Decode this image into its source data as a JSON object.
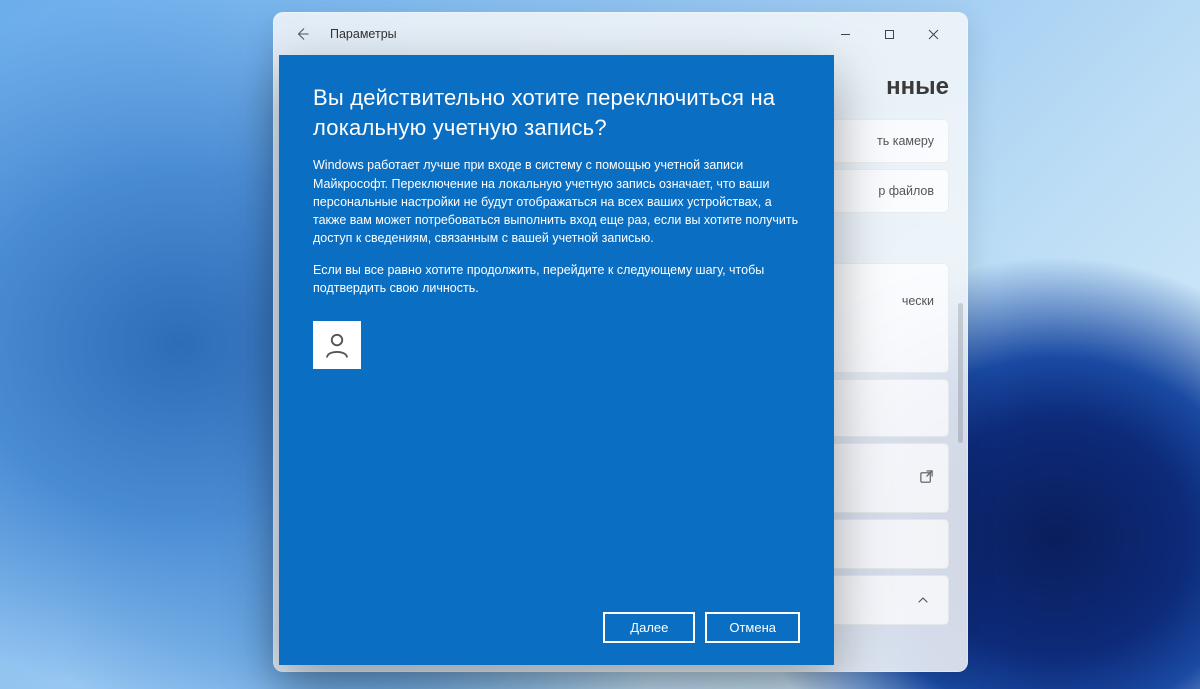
{
  "settings_window": {
    "title": "Параметры",
    "controls": {
      "back": "back-arrow",
      "minimize": "minimize",
      "maximize": "maximize",
      "close": "close"
    },
    "partial_heading": "нные",
    "cards": [
      {
        "text_fragment": "ть камеру"
      },
      {
        "text_fragment": "р файлов"
      },
      {
        "text_fragment": "чески"
      }
    ]
  },
  "modal": {
    "heading": "Вы действительно хотите переключиться на локальную учетную запись?",
    "body_paragraph_1": "Windows работает лучше при входе в систему с помощью учетной записи Майкрософт. Переключение на локальную учетную запись означает, что ваши персональные настройки не будут отображаться на всех ваших устройствах, а также вам может потребоваться выполнить вход еще раз, если вы хотите получить доступ к сведениям, связанным с вашей учетной записью.",
    "body_paragraph_2": "Если вы все равно хотите продолжить, перейдите к следующему шагу, чтобы подтвердить свою личность.",
    "avatar_icon": "person-icon",
    "buttons": {
      "next": "Далее",
      "cancel": "Отмена"
    }
  },
  "colors": {
    "modal_bg": "#0a6ec2",
    "modal_text": "#ffffff",
    "settings_bg": "rgba(245,247,249,0.86)",
    "accent": "#0a6ec2"
  }
}
